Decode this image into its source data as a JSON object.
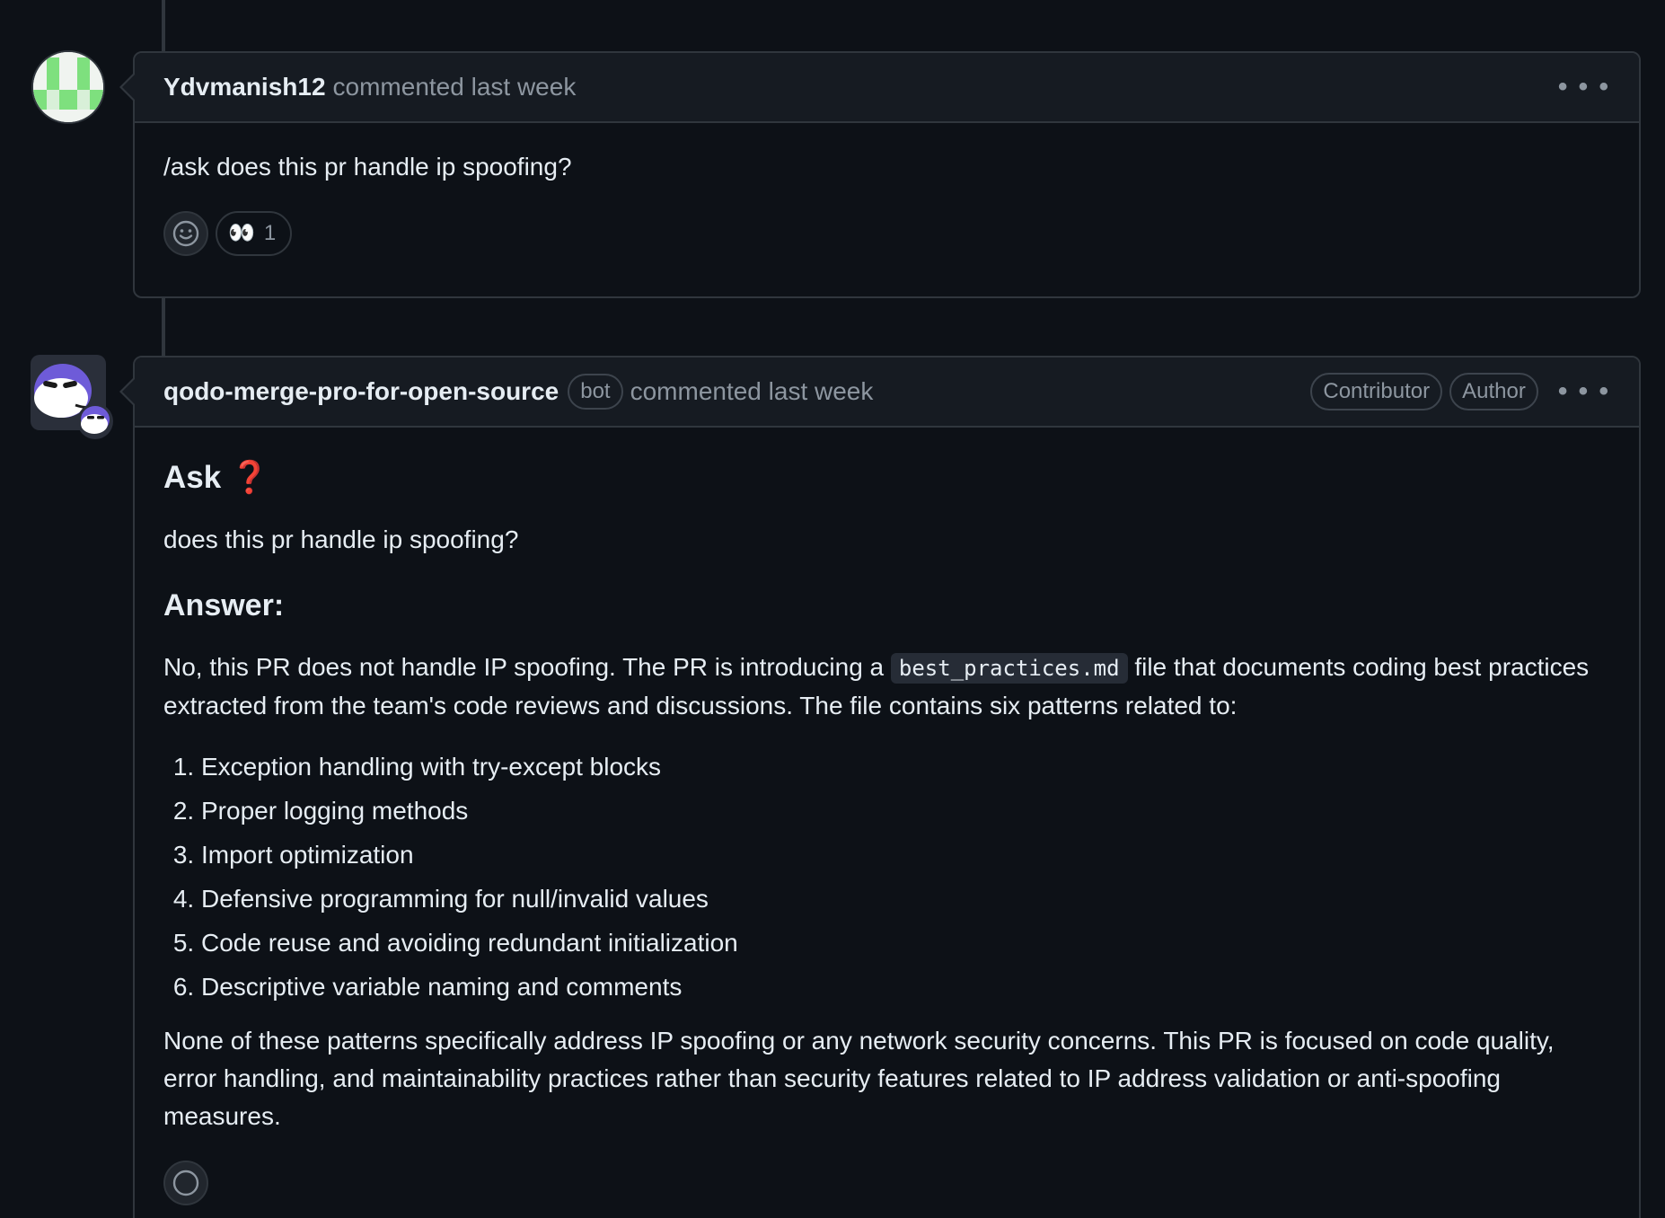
{
  "comments": [
    {
      "author": "Ydvmanish12",
      "meta": "commented last week",
      "body": "/ask does this pr handle ip spoofing?",
      "reaction": {
        "emoji": "👀",
        "count": "1"
      },
      "icons": {
        "menu": "kebab-icon",
        "add_reaction": "smiley-icon"
      }
    },
    {
      "author": "qodo-merge-pro-for-open-source",
      "bot_label": "bot",
      "meta": "commented last week",
      "badges": [
        "Contributor",
        "Author"
      ],
      "ask_title": "Ask",
      "ask_emoji": "❓",
      "question": "does this pr handle ip spoofing?",
      "answer_title": "Answer:",
      "answer_intro_before": "No, this PR does not handle IP spoofing. The PR is introducing a ",
      "answer_code": "best_practices.md",
      "answer_intro_after": " file that documents coding best practices extracted from the team's code reviews and discussions. The file contains six patterns related to:",
      "patterns": [
        "Exception handling with try-except blocks",
        "Proper logging methods",
        "Import optimization",
        "Defensive programming for null/invalid values",
        "Code reuse and avoiding redundant initialization",
        "Descriptive variable naming and comments"
      ],
      "conclusion": "None of these patterns specifically address IP spoofing or any network security concerns. This PR is focused on code quality, error handling, and maintainability practices rather than security features related to IP address validation or anti-spoofing measures."
    }
  ],
  "colors": {
    "background": "#0d1117",
    "header": "#161b22",
    "border": "#30363d",
    "muted": "#8d96a0",
    "accent_red": "#da3633",
    "avatar_green": "#7ee07e",
    "bot_purple": "#6e5bd8"
  }
}
